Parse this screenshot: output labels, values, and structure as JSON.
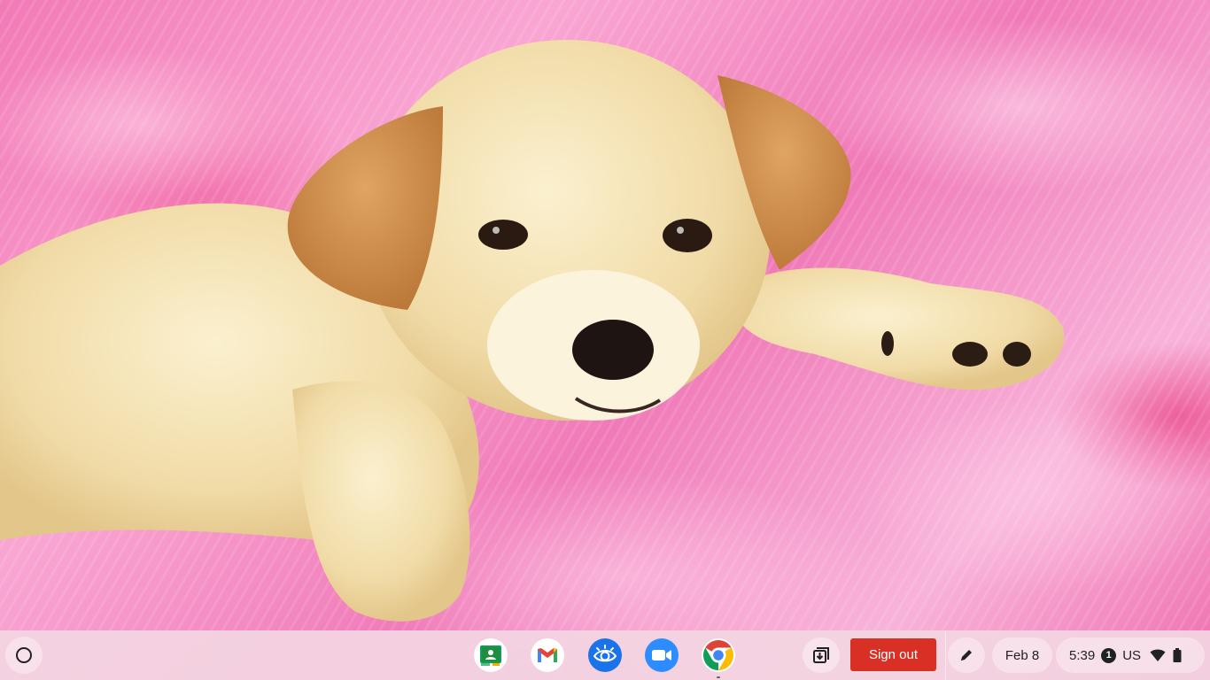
{
  "wallpaper": {
    "subject": "puppy on pink fur",
    "colors": {
      "fur_pink": "#f590c4",
      "fur_deep": "#e8347e",
      "puppy_cream": "#f4e1b0",
      "ear_tan": "#d29652"
    }
  },
  "shelf": {
    "launcher_icon": "launcher-circle-icon",
    "pinned_apps": [
      {
        "name": "Google Classroom",
        "icon": "classroom-icon",
        "running": false
      },
      {
        "name": "Gmail",
        "icon": "gmail-icon",
        "running": false
      },
      {
        "name": "Screen Reader",
        "icon": "eye-icon",
        "running": false
      },
      {
        "name": "Zoom",
        "icon": "zoom-camera-icon",
        "running": false
      },
      {
        "name": "Google Chrome",
        "icon": "chrome-icon",
        "running": true
      }
    ],
    "holding_space_icon": "holding-space-icon",
    "sign_out_label": "Sign out",
    "sign_out_color": "#d93025",
    "stylus_icon": "pen-icon",
    "date": "Feb 8",
    "tray": {
      "time": "5:39",
      "notification_count": "1",
      "ime": "US",
      "wifi_icon": "wifi-icon",
      "battery_icon": "battery-icon"
    }
  }
}
